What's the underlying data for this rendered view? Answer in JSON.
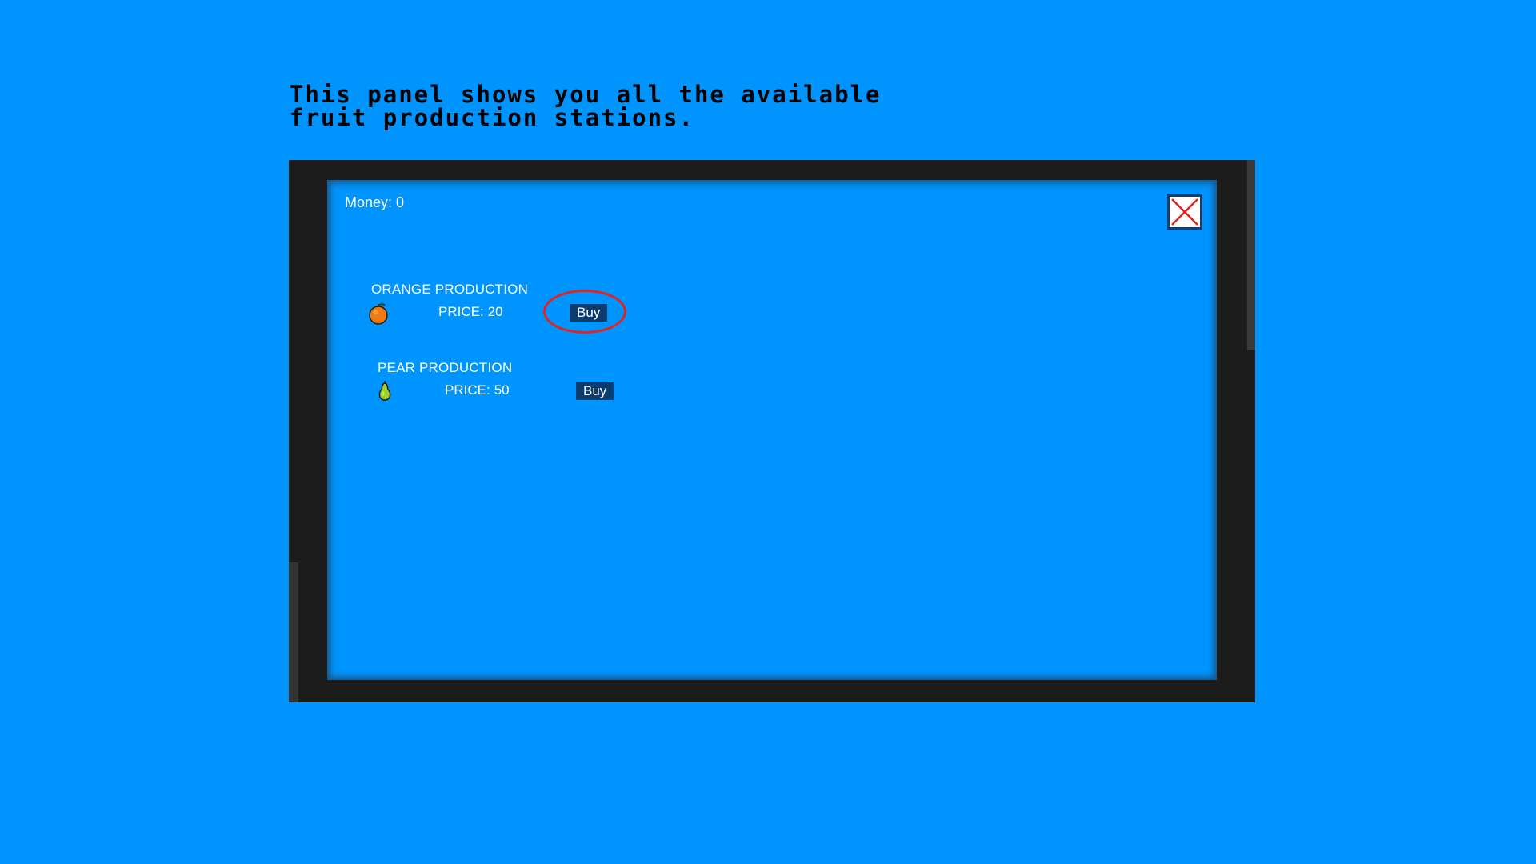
{
  "tutorial": {
    "text": "This panel shows you all the available\nfruit production stations."
  },
  "shop": {
    "money_label": "Money:",
    "money_value": "0",
    "items": [
      {
        "title": "ORANGE PRODUCTION",
        "price_label": "PRICE:",
        "price_value": "20",
        "buy_label": "Buy",
        "icon": "orange-icon",
        "highlighted": true
      },
      {
        "title": "PEAR PRODUCTION",
        "price_label": "PRICE:",
        "price_value": "50",
        "buy_label": "Buy",
        "icon": "pear-icon",
        "highlighted": false
      }
    ]
  },
  "colors": {
    "background": "#0094ff",
    "frame": "#1c1c1c",
    "buy_button": "#0b3c6e",
    "highlight": "#e3241e",
    "close_x": "#e3241e"
  }
}
